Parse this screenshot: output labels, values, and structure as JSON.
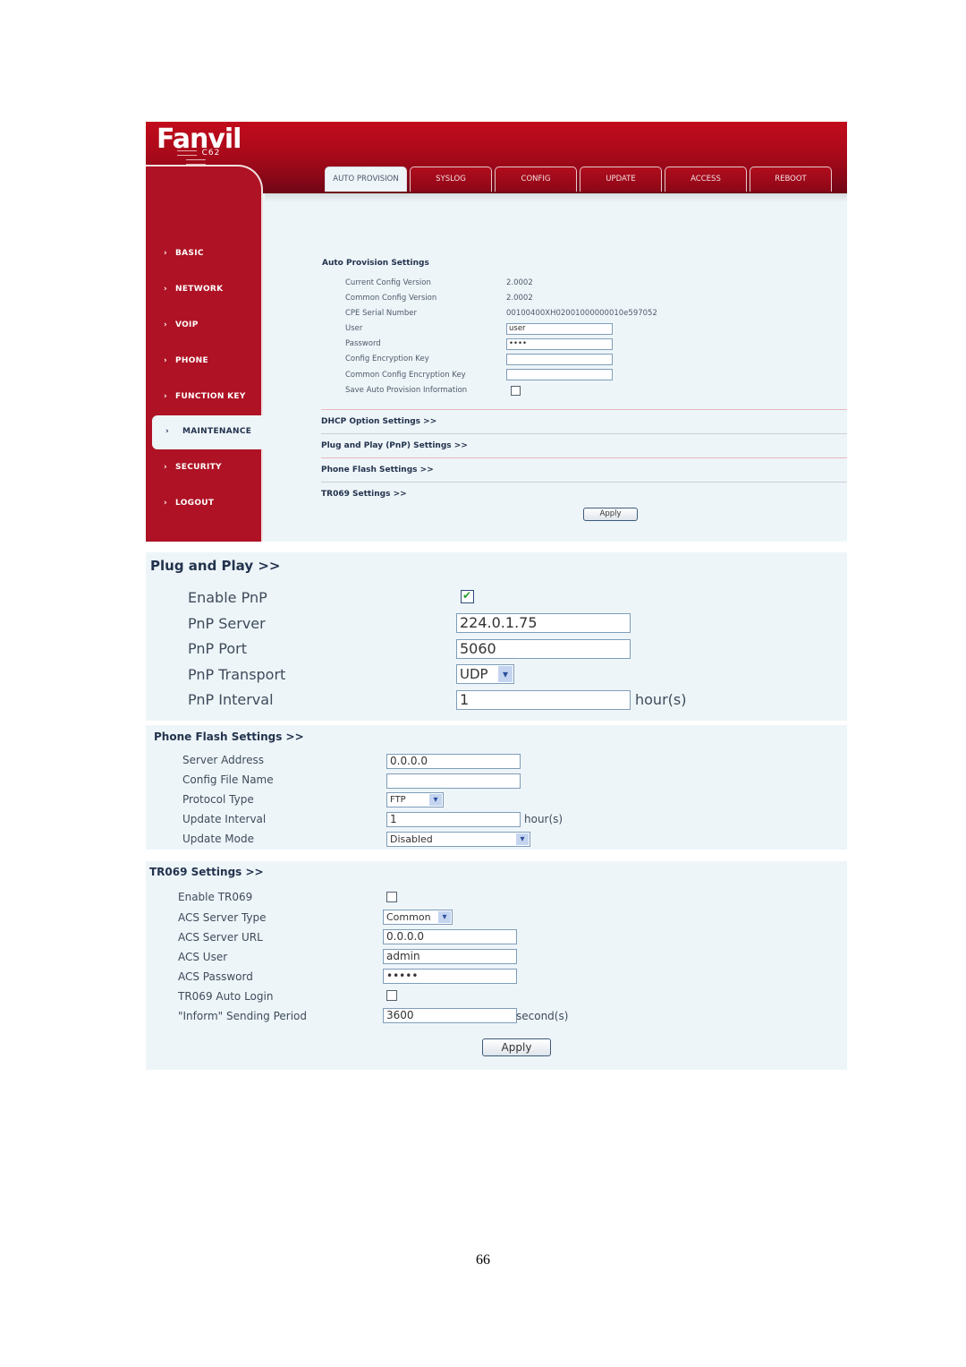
{
  "header": {
    "brand": "Fanvil",
    "model": "C62",
    "tabs": [
      {
        "label": "AUTO PROVISION",
        "active": true
      },
      {
        "label": "SYSLOG",
        "active": false
      },
      {
        "label": "CONFIG",
        "active": false
      },
      {
        "label": "UPDATE",
        "active": false
      },
      {
        "label": "ACCESS",
        "active": false
      },
      {
        "label": "REBOOT",
        "active": false
      }
    ]
  },
  "sidebar": {
    "chevron": "›",
    "items": [
      {
        "label": "BASIC",
        "active": false
      },
      {
        "label": "NETWORK",
        "active": false
      },
      {
        "label": "VOIP",
        "active": false
      },
      {
        "label": "PHONE",
        "active": false
      },
      {
        "label": "FUNCTION KEY",
        "active": false
      },
      {
        "label": "MAINTENANCE",
        "active": true
      },
      {
        "label": "SECURITY",
        "active": false
      },
      {
        "label": "LOGOUT",
        "active": false
      }
    ]
  },
  "auto_provision": {
    "title": "Auto Provision Settings",
    "current_config_version": {
      "label": "Current Config Version",
      "value": "2.0002"
    },
    "common_config_version": {
      "label": "Common Config Version",
      "value": "2.0002"
    },
    "cpe_serial": {
      "label": "CPE Serial Number",
      "value": "00100400XH02001000000010e597052"
    },
    "user": {
      "label": "User",
      "value": "user"
    },
    "password": {
      "label": "Password",
      "value": "••••"
    },
    "config_key": {
      "label": "Config Encryption Key",
      "value": ""
    },
    "common_key": {
      "label": "Common Config Encryption Key",
      "value": ""
    },
    "save_info": {
      "label": "Save Auto Provision Information",
      "checked": false
    },
    "links": [
      "DHCP Option Settings >>",
      "Plug and Play (PnP) Settings >>",
      "Phone Flash Settings >>",
      "TR069 Settings >>"
    ],
    "apply_label": "Apply"
  },
  "pnp": {
    "title": "Plug and Play >>",
    "enable": {
      "label": "Enable PnP",
      "checked": true
    },
    "server": {
      "label": "PnP Server",
      "value": "224.0.1.75"
    },
    "port": {
      "label": "PnP Port",
      "value": "5060"
    },
    "transport": {
      "label": "PnP Transport",
      "value": "UDP"
    },
    "interval": {
      "label": "PnP Interval",
      "value": "1",
      "unit": "hour(s)"
    }
  },
  "phone_flash": {
    "title": "Phone Flash Settings >>",
    "server_address": {
      "label": "Server Address",
      "value": "0.0.0.0"
    },
    "config_file": {
      "label": "Config File Name",
      "value": ""
    },
    "protocol": {
      "label": "Protocol Type",
      "value": "FTP"
    },
    "interval": {
      "label": "Update Interval",
      "value": "1",
      "unit": "hour(s)"
    },
    "mode": {
      "label": "Update Mode",
      "value": "Disabled"
    }
  },
  "tr069": {
    "title": "TR069 Settings >>",
    "enable": {
      "label": "Enable TR069",
      "checked": false
    },
    "server_type": {
      "label": "ACS Server Type",
      "value": "Common"
    },
    "server_url": {
      "label": "ACS Server URL",
      "value": "0.0.0.0"
    },
    "user": {
      "label": "ACS User",
      "value": "admin"
    },
    "password": {
      "label": "ACS Password",
      "value": "•••••"
    },
    "auto_login": {
      "label": "TR069 Auto Login",
      "checked": false
    },
    "period": {
      "label": "\"Inform\" Sending Period",
      "value": "3600",
      "unit": "second(s)"
    },
    "apply_label": "Apply"
  },
  "page_number": "66",
  "icons": {
    "dropdown": "▾",
    "check": "✔"
  },
  "colors": {
    "brand_red": "#ae1224",
    "panel_bg": "#eef5f9",
    "heading": "#23334d",
    "check_green": "#2aa12a"
  }
}
